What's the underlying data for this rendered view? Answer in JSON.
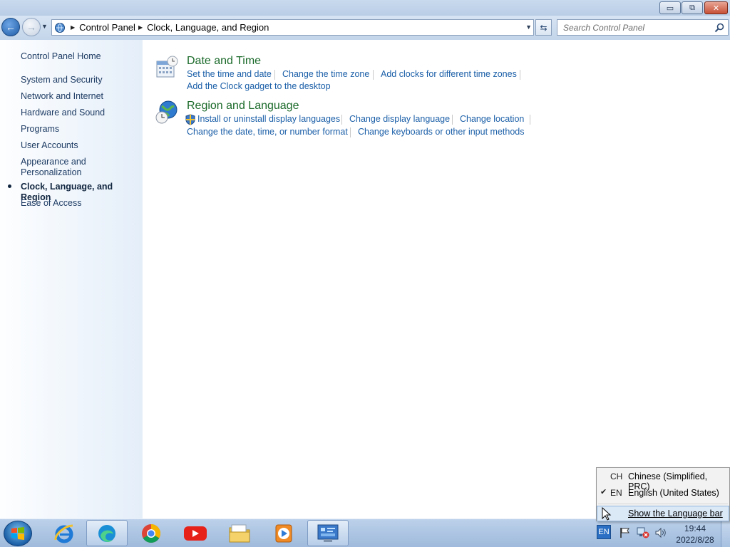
{
  "window": {
    "buttons": {
      "minimize": "▭",
      "maximize": "⧉",
      "close": "✕"
    }
  },
  "navigation": {
    "breadcrumbs": [
      "Control Panel",
      "Clock, Language, and Region"
    ],
    "search_placeholder": "Search Control Panel"
  },
  "sidebar": {
    "items": [
      {
        "label": "Control Panel Home"
      },
      {
        "label": "System and Security"
      },
      {
        "label": "Network and Internet"
      },
      {
        "label": "Hardware and Sound"
      },
      {
        "label": "Programs"
      },
      {
        "label": "User Accounts"
      },
      {
        "label": "Appearance and Personalization"
      },
      {
        "label": "Clock, Language, and Region",
        "current": true
      },
      {
        "label": "Ease of Access"
      }
    ],
    "appearance_line1": "Appearance and",
    "appearance_line2": "Personalization"
  },
  "categories": [
    {
      "title": "Date and Time",
      "icon": "calendar-clock-icon",
      "tasks": [
        "Set the time and date",
        "Change the time zone",
        "Add clocks for different time zones",
        "Add the Clock gadget to the desktop"
      ]
    },
    {
      "title": "Region and Language",
      "icon": "globe-clock-icon",
      "tasks": [
        "Install or uninstall display languages",
        "Change display language",
        "Change location",
        "Change the date, time, or number format",
        "Change keyboards or other input methods"
      ]
    }
  ],
  "taskbar": {
    "apps": [
      "internet-explorer-icon",
      "edge-icon",
      "chrome-icon",
      "youtube-icon",
      "file-explorer-icon",
      "media-player-icon",
      "control-panel-icon"
    ],
    "language_indicator": "EN",
    "clock": {
      "time": "19:44",
      "date": "2022/8/28"
    }
  },
  "language_menu": {
    "items": [
      {
        "code": "CH",
        "label": "Chinese (Simplified, PRC)",
        "checked": false
      },
      {
        "code": "EN",
        "label": "English (United States)",
        "checked": true
      }
    ],
    "show_bar_label": "Show the Language bar"
  },
  "colors": {
    "category_title": "#1b6a2a",
    "task_link": "#1b5fa8",
    "sidebar_link": "#1e3c64",
    "taskbar": "#a8c2e2"
  }
}
